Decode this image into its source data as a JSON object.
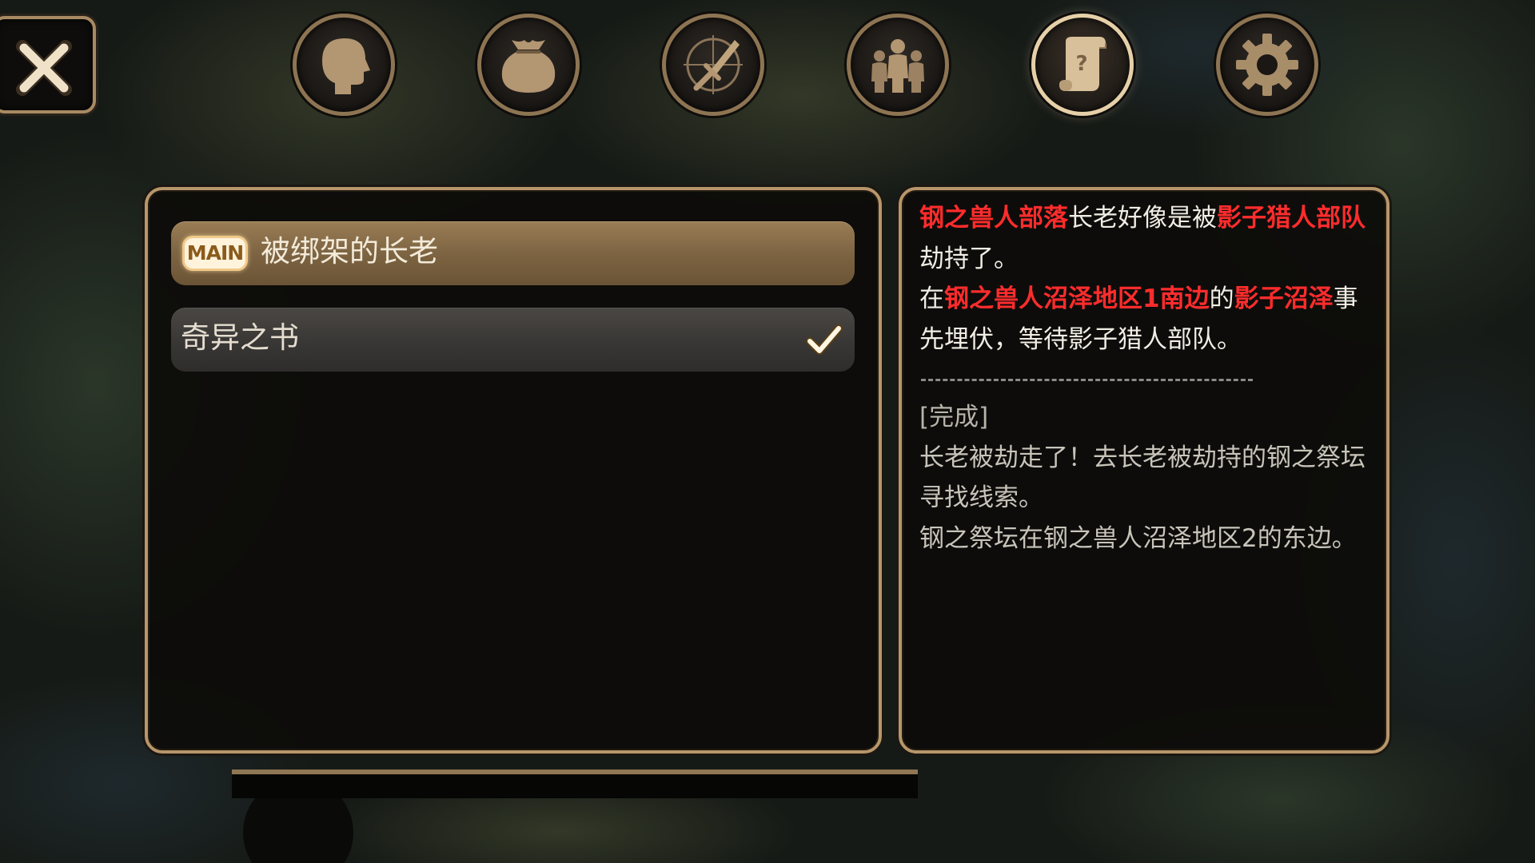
{
  "topbar": {
    "close_icon": "close-x-icon",
    "tabs": [
      {
        "icon": "head-profile-icon",
        "active": false
      },
      {
        "icon": "bag-icon",
        "active": false
      },
      {
        "icon": "sword-compass-icon",
        "active": false
      },
      {
        "icon": "party-icon",
        "active": false
      },
      {
        "icon": "quest-scroll-icon",
        "active": true
      },
      {
        "icon": "gear-icon",
        "active": false
      }
    ]
  },
  "quest_list": {
    "items": [
      {
        "badge": "MAIN",
        "title": "被绑架的长老",
        "selected": true,
        "completed": false
      },
      {
        "badge": "",
        "title": "奇异之书",
        "selected": false,
        "completed": true,
        "status_icon": "checkmark-icon"
      }
    ]
  },
  "quest_detail": {
    "segments_1": [
      {
        "text": "钢之兽人部落",
        "highlight": true
      },
      {
        "text": "长老好像是被",
        "highlight": false
      },
      {
        "text": "影子猎人部队",
        "highlight": true
      },
      {
        "text": "劫持了。",
        "highlight": false
      }
    ],
    "segments_2": [
      {
        "text": "在",
        "highlight": false
      },
      {
        "text": "钢之兽人沼泽地区1南边",
        "highlight": true
      },
      {
        "text": "的",
        "highlight": false
      },
      {
        "text": "影子沼泽",
        "highlight": true
      },
      {
        "text": "事先埋伏，等待影子猎人部队。",
        "highlight": false
      }
    ],
    "completed_label": "[完成]",
    "completed_text_1": "长老被劫走了！去长老被劫持的钢之祭坛寻找线索。",
    "completed_text_2": "钢之祭坛在钢之兽人沼泽地区2的东边。"
  },
  "colors": {
    "highlight": "#ff2c2c",
    "frame": "#b7966a",
    "selected_row": "#8a6f4b"
  }
}
